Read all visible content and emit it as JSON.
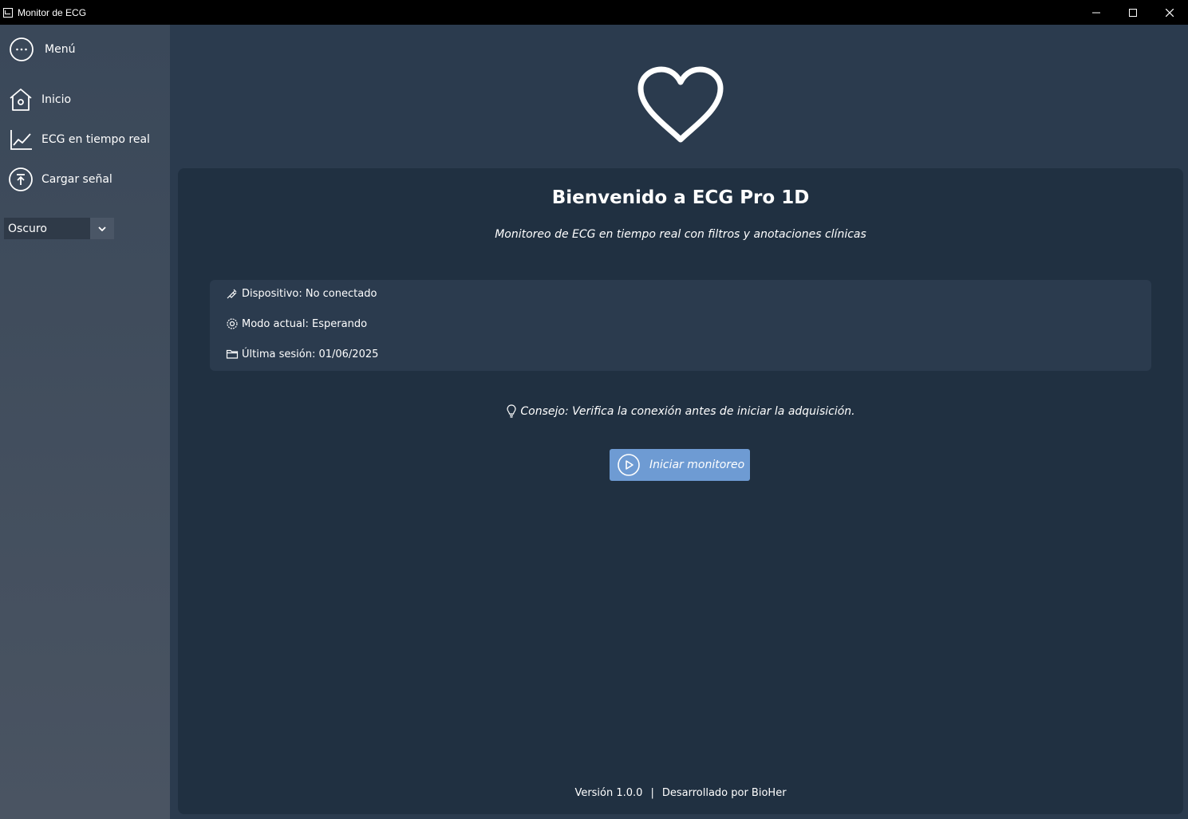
{
  "window": {
    "title": "Monitor de ECG",
    "controls": [
      "minimize-icon",
      "maximize-icon",
      "close-icon"
    ]
  },
  "sidebar": {
    "menu_label": "Menú",
    "items": [
      {
        "label": "Inicio",
        "icon": "home-icon"
      },
      {
        "label": "ECG en tiempo real",
        "icon": "chart-line-icon"
      },
      {
        "label": "Cargar señal",
        "icon": "upload-icon"
      }
    ],
    "theme_select": {
      "value": "Oscuro"
    }
  },
  "main": {
    "logo_icon": "heart-icon",
    "heading": "Bienvenido a ECG Pro 1D",
    "subtitle": "Monitoreo de ECG en tiempo real con filtros y anotaciones clínicas",
    "info": {
      "device": "Dispositivo: No conectado",
      "mode": "Modo actual: Esperando",
      "last_session": "Última sesión: 01/06/2025"
    },
    "tip": "Consejo: Verifica la conexión antes de iniciar la adquisición.",
    "start_button": "Iniciar monitoreo",
    "footer": {
      "version": "Versión 1.0.0",
      "separator": "|",
      "developer": "Desarrollado por BioHer"
    }
  },
  "colors": {
    "sidebar_bg": "#3a4859",
    "main_bg": "#2b3b4e",
    "card_bg": "#203041",
    "accent": "#6e9bd3"
  }
}
